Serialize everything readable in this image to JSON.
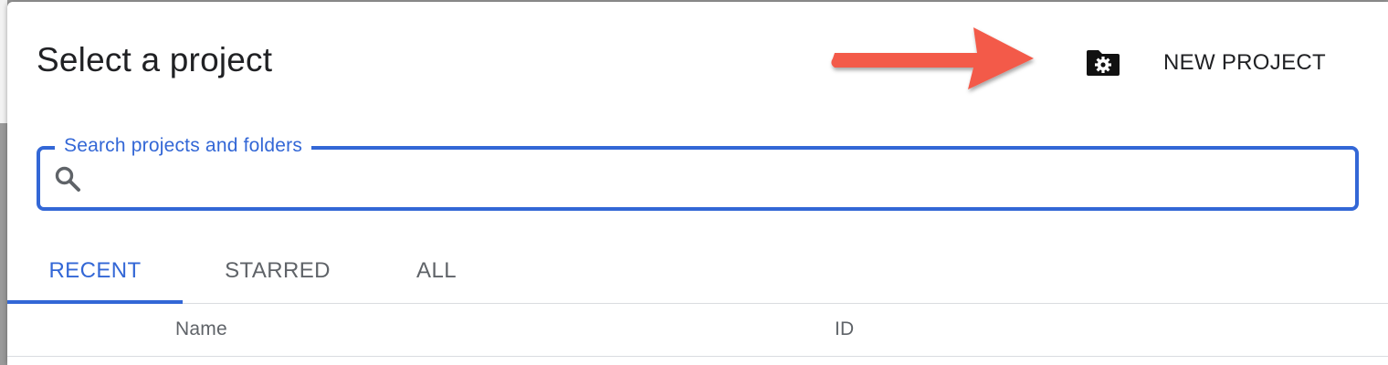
{
  "dialog": {
    "title": "Select a project",
    "new_project_label": "NEW PROJECT",
    "new_project_icon": "folder-settings-icon"
  },
  "annotation": {
    "arrow_color": "#f35a4a"
  },
  "search": {
    "label": "Search projects and folders",
    "value": "",
    "placeholder": "",
    "icon": "search-icon"
  },
  "tabs": [
    {
      "label": "RECENT",
      "active": true
    },
    {
      "label": "STARRED",
      "active": false
    },
    {
      "label": "ALL",
      "active": false
    }
  ],
  "table": {
    "columns": [
      "Name",
      "ID"
    ]
  },
  "colors": {
    "accent": "#3367d6",
    "text_primary": "#202124",
    "text_secondary": "#5f6368",
    "divider": "#dadce0"
  }
}
